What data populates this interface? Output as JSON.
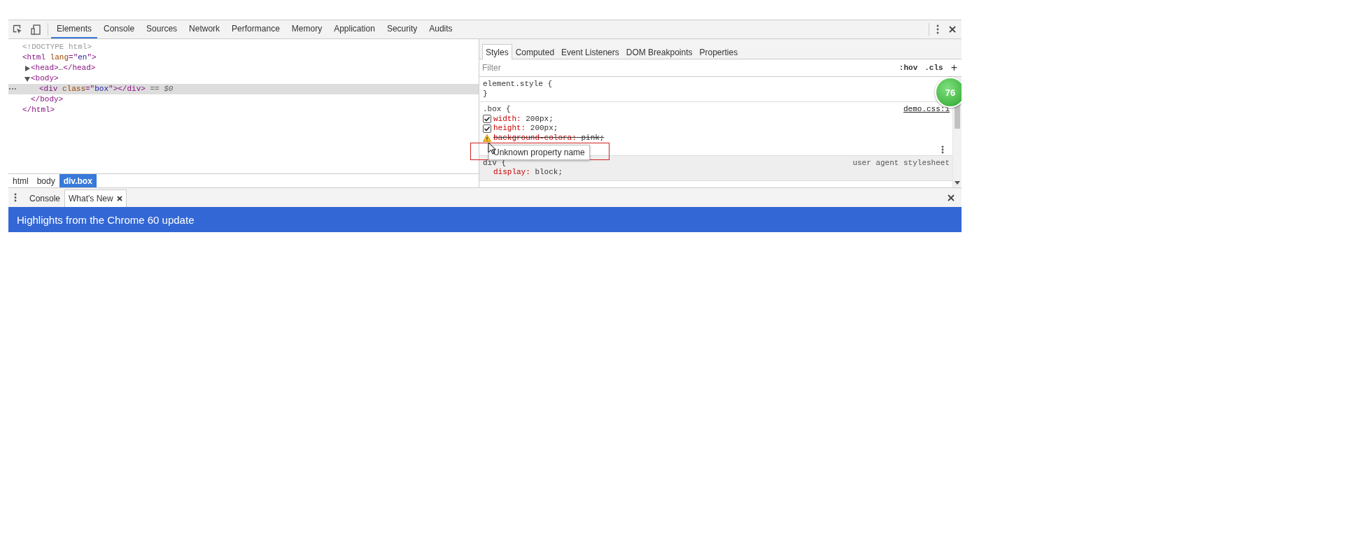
{
  "toolbar": {
    "tabs": [
      {
        "label": "Elements",
        "selected": true
      },
      {
        "label": "Console",
        "selected": false
      },
      {
        "label": "Sources",
        "selected": false
      },
      {
        "label": "Network",
        "selected": false
      },
      {
        "label": "Performance",
        "selected": false
      },
      {
        "label": "Memory",
        "selected": false
      },
      {
        "label": "Application",
        "selected": false
      },
      {
        "label": "Security",
        "selected": false
      },
      {
        "label": "Audits",
        "selected": false
      }
    ]
  },
  "elements": {
    "nodes": [
      {
        "parts": [
          {
            "kind": "doctype",
            "text": "<!DOCTYPE html>"
          }
        ],
        "selected": false
      },
      {
        "parts": [
          {
            "kind": "tag",
            "text": "<html"
          },
          {
            "kind": "attr",
            "text": " lang"
          },
          {
            "kind": "tag",
            "text": "=\""
          },
          {
            "kind": "value",
            "text": "en"
          },
          {
            "kind": "tag",
            "text": "\">"
          }
        ],
        "selected": false,
        "close": [
          {
            "kind": "tag",
            "text": "</html>"
          }
        ],
        "children": [
          {
            "parts": [
              {
                "kind": "tag",
                "text": "<head>"
              },
              {
                "kind": "plain",
                "text": "…"
              },
              {
                "kind": "tag",
                "text": "</head>"
              }
            ],
            "expanded": false,
            "selected": false
          },
          {
            "parts": [
              {
                "kind": "tag",
                "text": "<body>"
              }
            ],
            "expanded": true,
            "selected": false,
            "close": [
              {
                "kind": "tag",
                "text": "</body>"
              }
            ],
            "children": [
              {
                "parts": [
                  {
                    "kind": "tag",
                    "text": "<div"
                  },
                  {
                    "kind": "attr",
                    "text": " class"
                  },
                  {
                    "kind": "tag",
                    "text": "=\""
                  },
                  {
                    "kind": "value",
                    "text": "box"
                  },
                  {
                    "kind": "tag",
                    "text": "\"></div>"
                  }
                ],
                "suffix": "== $0",
                "selected": true
              }
            ]
          }
        ]
      }
    ],
    "breadcrumbs": [
      {
        "label": "html",
        "selected": false
      },
      {
        "label": "body",
        "selected": false
      },
      {
        "label": "div.box",
        "selected": true
      }
    ]
  },
  "styles": {
    "tabs": [
      {
        "label": "Styles",
        "selected": true
      },
      {
        "label": "Computed",
        "selected": false
      },
      {
        "label": "Event Listeners",
        "selected": false
      },
      {
        "label": "DOM Breakpoints",
        "selected": false
      },
      {
        "label": "Properties",
        "selected": false
      }
    ],
    "filter": {
      "placeholder": "Filter"
    },
    "hov": ":hov",
    "cls": ".cls",
    "add": "+",
    "rules": [
      {
        "selector": "element.style {",
        "close": "}",
        "user_agent": false,
        "hovered": false
      },
      {
        "selector": ".box {",
        "source": "demo.css:1",
        "user_agent": false,
        "hovered": true,
        "properties": [
          {
            "name": "width:",
            "value": "200px;",
            "kind": "enabled",
            "checked": true
          },
          {
            "name": "height:",
            "value": "200px;",
            "kind": "enabled",
            "checked": true
          },
          {
            "name": "background-colora:",
            "value": "pink;",
            "kind": "invalid"
          }
        ]
      },
      {
        "selector": "div {",
        "source": "user agent stylesheet",
        "user_agent": true,
        "hovered": false,
        "properties": [
          {
            "name": "display:",
            "value": "block;",
            "kind": "plain"
          }
        ]
      }
    ],
    "tooltip": "Unknown property name",
    "badge": "76"
  },
  "drawer": {
    "tabs": [
      {
        "label": "Console",
        "selected": false,
        "closable": false
      },
      {
        "label": "What's New",
        "selected": true,
        "closable": true
      }
    ],
    "banner": "Highlights from the Chrome 60 update"
  }
}
